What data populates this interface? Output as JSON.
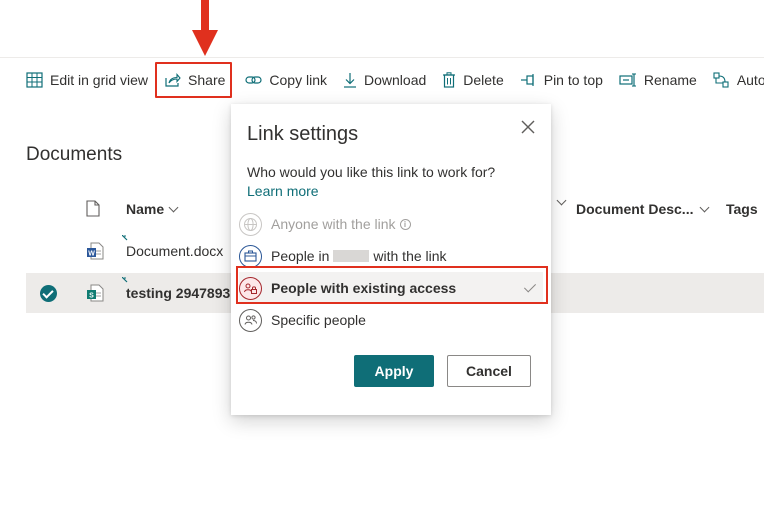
{
  "toolbar": {
    "items": [
      {
        "label": "Edit in grid view",
        "icon": "grid-icon"
      },
      {
        "label": "Share",
        "icon": "share-icon"
      },
      {
        "label": "Copy link",
        "icon": "link-icon"
      },
      {
        "label": "Download",
        "icon": "download-icon"
      },
      {
        "label": "Delete",
        "icon": "trash-icon"
      },
      {
        "label": "Pin to top",
        "icon": "pin-icon"
      },
      {
        "label": "Rename",
        "icon": "rename-icon"
      },
      {
        "label": "Auto",
        "icon": "automate-icon"
      }
    ]
  },
  "library": {
    "title": "Documents",
    "columns": {
      "name": "Name",
      "description": "Document Desc...",
      "tags": "Tags"
    },
    "rows": [
      {
        "name": "Document.docx",
        "type": "word",
        "selected": false
      },
      {
        "name": "testing 2947893.",
        "type": "sway",
        "selected": true
      }
    ]
  },
  "dialog": {
    "title": "Link settings",
    "question": "Who would you like this link to work for?",
    "learn_more": "Learn more",
    "options": [
      {
        "label": "Anyone with the link",
        "disabled": true
      },
      {
        "label_prefix": "People in",
        "label_suffix": "with the link",
        "disabled": false
      },
      {
        "label": "People with existing access",
        "selected": true
      },
      {
        "label": "Specific people",
        "selected": false
      }
    ],
    "apply_label": "Apply",
    "cancel_label": "Cancel"
  },
  "colors": {
    "accent": "#0f6e77",
    "annotation": "#e0301e"
  }
}
